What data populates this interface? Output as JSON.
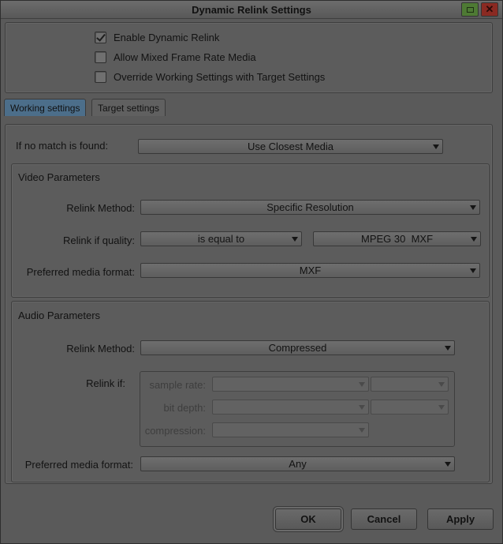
{
  "window": {
    "title": "Dynamic Relink Settings"
  },
  "options": [
    {
      "label": "Enable Dynamic Relink",
      "checked": true
    },
    {
      "label": "Allow Mixed Frame Rate Media",
      "checked": false
    },
    {
      "label": "Override Working Settings with Target Settings",
      "checked": false
    }
  ],
  "tabs": [
    {
      "label": "Working settings",
      "active": true
    },
    {
      "label": "Target settings",
      "active": false
    }
  ],
  "no_match": {
    "label": "If no match is found:",
    "value": "Use Closest Media"
  },
  "video": {
    "title": "Video Parameters",
    "relink_method_label": "Relink Method:",
    "relink_method_value": "Specific Resolution",
    "relink_quality_label": "Relink if quality:",
    "quality_operator": "is equal to",
    "quality_value": "MPEG 30  MXF",
    "preferred_format_label": "Preferred media format:",
    "preferred_format_value": "MXF"
  },
  "audio": {
    "title": "Audio Parameters",
    "relink_method_label": "Relink Method:",
    "relink_method_value": "Compressed",
    "relink_if_label": "Relink if:",
    "sample_rate_label": "sample rate:",
    "bit_depth_label": "bit depth:",
    "compression_label": "compression:",
    "preferred_format_label": "Preferred media format:",
    "preferred_format_value": "Any"
  },
  "buttons": {
    "ok": "OK",
    "cancel": "Cancel",
    "apply": "Apply"
  },
  "icons": {
    "minimize": "minimize-icon",
    "close": "close-icon",
    "dropdown": "chevron-down-icon"
  },
  "colors": {
    "window_bg": "#5a5a5a",
    "active_tab": "#4c6e8a",
    "close_button": "#8a2a22",
    "minimize_button": "#4e7a34"
  }
}
